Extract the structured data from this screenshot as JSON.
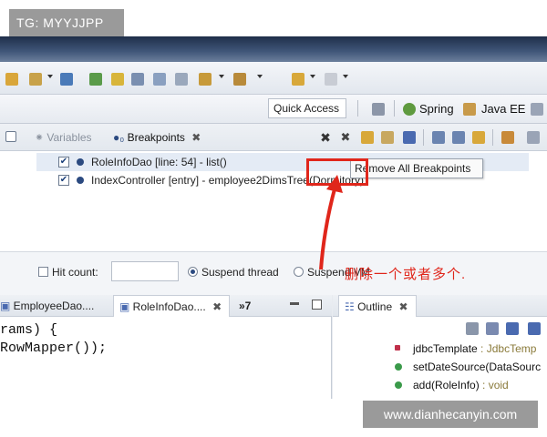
{
  "watermarks": {
    "top": "TG: MYYJJPP",
    "bottom": "www.dianhecanyin.com"
  },
  "toolbar": {
    "quick_access": "Quick Access",
    "perspectives": [
      "Spring",
      "Java EE"
    ]
  },
  "breakpoints_view": {
    "tabs": [
      "Variables",
      "Breakpoints"
    ],
    "items": [
      {
        "label": "RoleInfoDao [line: 54] - list()",
        "checked": true
      },
      {
        "label": "IndexController [entry] - employee2DimsTree(Dormitory)",
        "checked": true
      }
    ],
    "tooltip": "Remove All Breakpoints",
    "options": {
      "hit_count": "Hit count:",
      "suspend_thread": "Suspend thread",
      "suspend_vm": "Suspend VM"
    }
  },
  "annotation": "删除一个或者多个.",
  "editor": {
    "tabs": [
      "EmployeeDao....",
      "RoleInfoDao....",
      "»7"
    ],
    "code": [
      "rams) {",
      "RowMapper());"
    ]
  },
  "outline": {
    "tab": "Outline",
    "items": [
      {
        "name": "jdbcTemplate",
        "type": " : JdbcTemp"
      },
      {
        "name": "setDateSource(DataSourc",
        "type": ""
      },
      {
        "name": "add(RoleInfo)",
        "type": " : void"
      }
    ]
  },
  "colors": {
    "annotation_red": "#e0261b",
    "title_band": "#2b3e5f"
  }
}
